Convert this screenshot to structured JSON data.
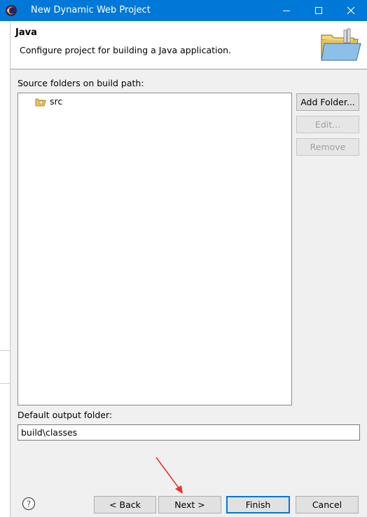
{
  "window": {
    "title": "New Dynamic Web Project"
  },
  "header": {
    "title": "Java",
    "description": "Configure project for building a Java application."
  },
  "source_folders": {
    "label": "Source folders on build path:",
    "items": [
      {
        "label": "src"
      }
    ],
    "buttons": {
      "add": "Add Folder...",
      "edit": "Edit...",
      "remove": "Remove"
    }
  },
  "output": {
    "label": "Default output folder:",
    "value": "build\\classes"
  },
  "footer": {
    "back": "< Back",
    "next": "Next >",
    "finish": "Finish",
    "cancel": "Cancel"
  },
  "colors": {
    "titlebar": "#0078d7",
    "annotation_arrow": "#e8322f",
    "default_button_border": "#0078d7"
  },
  "icons": [
    "eclipse-app-icon",
    "minimize-icon",
    "maximize-icon",
    "close-icon",
    "java-folder-banner-icon",
    "package-folder-icon",
    "help-icon",
    "red-arrow-annotation"
  ]
}
